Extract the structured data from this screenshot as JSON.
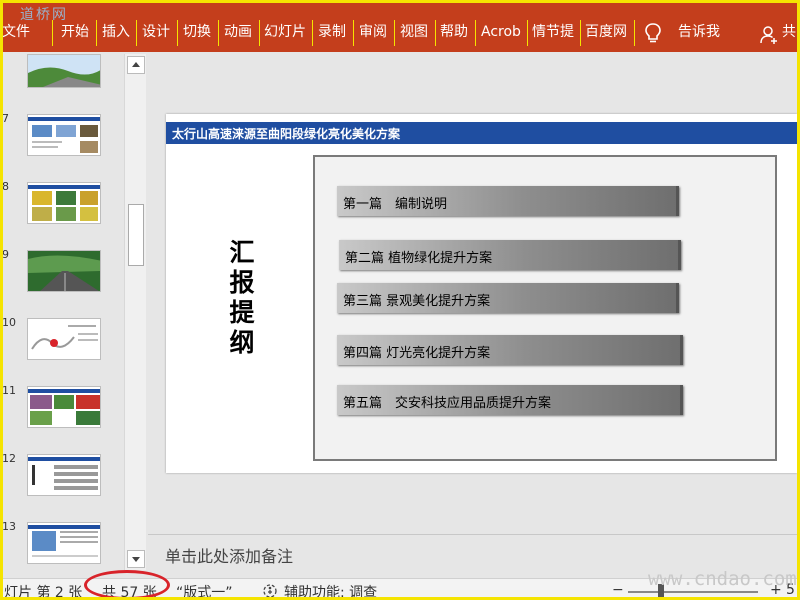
{
  "ribbon": {
    "watermark": "道桥网",
    "tabs": [
      "文件",
      "开始",
      "插入",
      "设计",
      "切换",
      "动画",
      "幻灯片",
      "录制",
      "审阅",
      "视图",
      "帮助",
      "Acrob",
      "情节提",
      "百度网"
    ],
    "tell_me": "告诉我",
    "share": "共"
  },
  "thumbnails": {
    "numbers": [
      "7",
      "8",
      "9",
      "10",
      "11",
      "12",
      "13"
    ]
  },
  "slide": {
    "title": "太行山高速涞源至曲阳段绿化亮化美化方案",
    "vertical_text": "汇报提纲",
    "chapters": [
      "第一篇　编制说明",
      "第二篇  植物绿化提升方案",
      "第三篇  景观美化提升方案",
      "第四篇  灯光亮化提升方案",
      "第五篇　交安科技应用品质提升方案"
    ]
  },
  "notes": {
    "placeholder": "单击此处添加备注"
  },
  "status": {
    "slide_label": "灯片 第 2 张",
    "total": "共 57 张",
    "layout": "“版式一”",
    "accessibility": "辅助功能: 调查",
    "zoom_minus": "−",
    "zoom_plus": "+",
    "watermark": "www.cndao.com",
    "zoom_partial": "5"
  },
  "colors": {
    "ribbon": "#c43e1c",
    "slide_header": "#1f4ea1",
    "annotation_circle": "#d8232a",
    "frame": "#f5e400"
  }
}
